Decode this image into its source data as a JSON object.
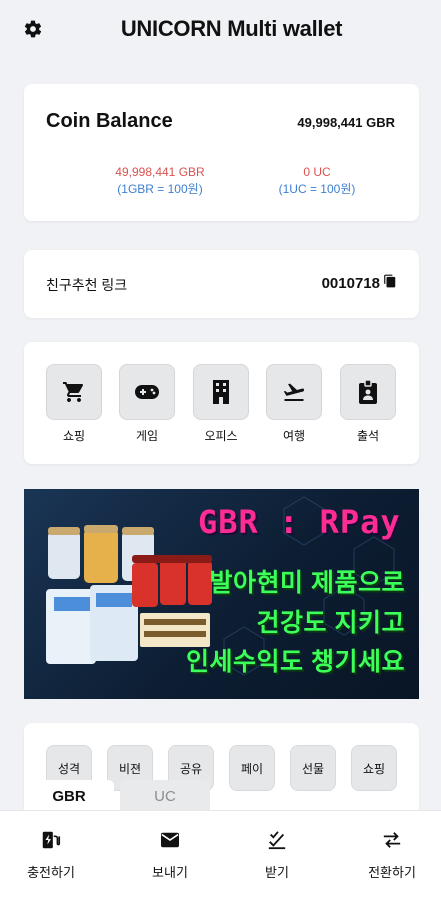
{
  "header": {
    "title": "UNICORN Multi wallet"
  },
  "balance": {
    "title": "Coin Balance",
    "total": "49,998,441 GBR",
    "gbr_value": "49,998,441 GBR",
    "gbr_rate": "(1GBR = 100원)",
    "uc_value": "0 UC",
    "uc_rate": "(1UC = 100원)",
    "value_color": "#d9534f",
    "rate_color": "#3d7fd1"
  },
  "referral": {
    "label": "친구추천 링크",
    "code": "0010718"
  },
  "menu": {
    "items": [
      {
        "label": "쇼핑",
        "icon": "cart-icon"
      },
      {
        "label": "게임",
        "icon": "gamepad-icon"
      },
      {
        "label": "오피스",
        "icon": "building-icon"
      },
      {
        "label": "여행",
        "icon": "airplane-icon"
      },
      {
        "label": "출석",
        "icon": "badge-icon"
      }
    ]
  },
  "banner": {
    "title": "GBR : RPay",
    "line1": "발아현미 제품으로",
    "line2": "건강도 지키고",
    "line3": "인세수익도 챙기세요",
    "title_color": "#ff2d93",
    "text_color": "#3dff5a"
  },
  "categories": [
    "성격",
    "비젼",
    "공유",
    "페이",
    "선물",
    "쇼핑"
  ],
  "tabs": {
    "active": "GBR",
    "inactive": "UC"
  },
  "bottom_nav": {
    "items": [
      {
        "label": "충전하기",
        "icon": "charge-icon"
      },
      {
        "label": "보내기",
        "icon": "mail-icon"
      },
      {
        "label": "받기",
        "icon": "double-check-icon"
      },
      {
        "label": "전환하기",
        "icon": "swap-icon"
      }
    ]
  }
}
